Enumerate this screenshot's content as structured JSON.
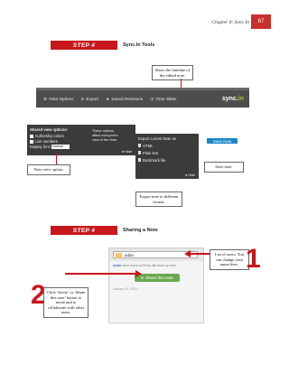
{
  "header": {
    "chapter": "Chapter 8: Sync.In",
    "page": "67"
  },
  "step1": {
    "label": "STEP 4",
    "title": "Sync.In Tools",
    "callouts": {
      "timeline": "Show the timeline of the edited note.",
      "save": "Save note.",
      "view": "Note view option.",
      "export": "Export note in different format."
    },
    "toolbar": {
      "items": [
        "Note Options",
        "Export",
        "Saved Revisions",
        "Time Slider"
      ],
      "logo_main": "sync.",
      "logo_accent": "in"
    },
    "view_panel": {
      "heading": "Shared view options:",
      "options": [
        "Authorship colors",
        "Line numbers"
      ],
      "font_label": "Display font:",
      "font_value": "Normal",
      "note": "These options affect everyone's view of the Note.",
      "hide": "Hide"
    },
    "export_panel": {
      "heading": "Export current Note as",
      "formats": [
        "HTML",
        "Plain text",
        "Bookmark file"
      ],
      "hide": "Hide"
    },
    "save_button": "Save Now"
  },
  "step2": {
    "label": "STEP 4",
    "title": "Sharing a Note",
    "callouts": {
      "list_users": "List of users. You can change your name here.",
      "invite": "Click ‘Invite’ or ‘Share this note’ button to invite and to collaborate with other users."
    },
    "share_panel": {
      "user": "adda",
      "hint_link": "Invite",
      "hint_rest": "other users and they will show up here.",
      "button": "Share this note",
      "date": "January 15, 2012"
    },
    "numbers": [
      "1",
      "2"
    ]
  },
  "colors": {
    "accent": "#c8171d",
    "toolbar": "#4d4d4d",
    "save": "#1a87c9",
    "share": "#6aa84f"
  }
}
